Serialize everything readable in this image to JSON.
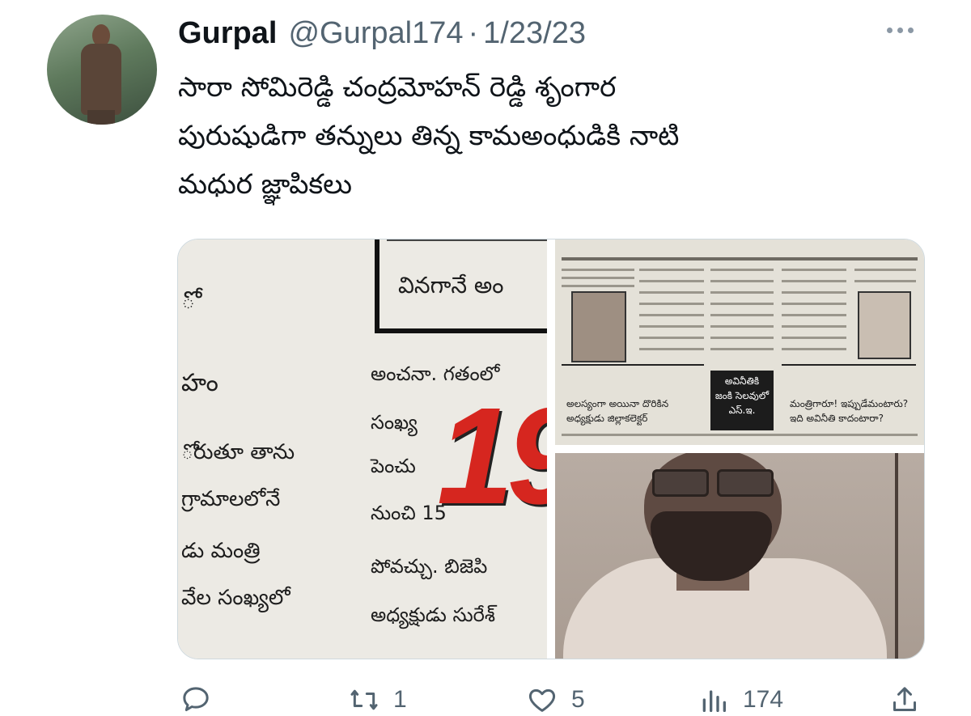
{
  "author": {
    "name": "Gurpal",
    "handle": "@Gurpal174",
    "separator": "·",
    "date": "1/23/23"
  },
  "tweet": {
    "text": "సారా సోమిరెడ్డి చంద్రమోహన్ రెడ్డి శృంగార\nపురుషుడిగా  తన్నులు తిన్న కామఅంధుడికి  నాటి\nమధుర జ్ఞాపికలు"
  },
  "media": {
    "left_clipping": {
      "left_column": [
        "ో",
        "హం",
        "ోరుతూ తాను",
        "గ్రామాలలోనే",
        "డు మంత్రి",
        "వేల సంఖ్యలో"
      ],
      "boxed_text": [
        "వినగానే అం"
      ],
      "right_column": [
        "అంచనా. గతంలో",
        "సంఖ్య",
        "పెంచు",
        "నుంచి 15",
        "పోవచ్చు. బిజెపి",
        "అధ్యక్షుడు సురేశ్"
      ],
      "big_number": "19"
    },
    "top_right_clipping": {
      "headline_box": "అవినీతికి\nజంకి సెలవులో\nఎస్.ఇ.",
      "caption_left": "అలస్యంగా అయినా దొరికిన\nఅధ్యక్షుడు జిల్లాకలెక్టర్",
      "caption_right": "మంత్రిగారూ! ఇప్పుడేమంటారు?\nఇది అవినీతి కాదంటారా?"
    }
  },
  "actions": {
    "reply_count": "",
    "retweet_count": "1",
    "like_count": "5",
    "views_count": "174"
  },
  "icons": {
    "reply": "reply-icon",
    "retweet": "retweet-icon",
    "like": "like-icon",
    "views": "views-icon",
    "share": "share-icon",
    "more": "more-icon"
  },
  "colors": {
    "text_primary": "#0f1419",
    "text_secondary": "#536471"
  }
}
